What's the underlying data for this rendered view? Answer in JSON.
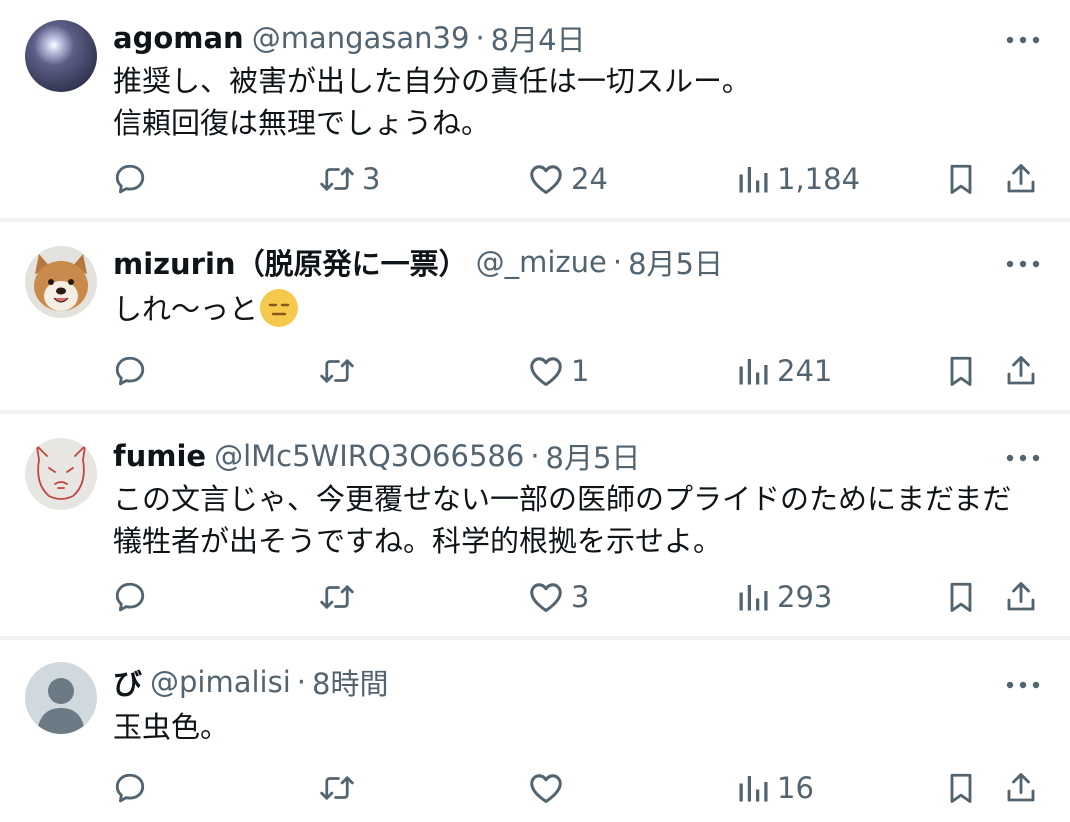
{
  "posts": [
    {
      "name": "agoman",
      "handle": "@mangasan39",
      "separator": "·",
      "time": "8月4日",
      "text": "推奨し、被害が出した自分の責任は一切スルー。\n信頼回復は無理でしょうね。",
      "replies": "",
      "reposts": "3",
      "likes": "24",
      "views": "1,184",
      "avatar": "dark-orb-avatar"
    },
    {
      "name": "mizurin（脱原発に一票）",
      "handle": "@_mizue",
      "separator": "·",
      "time": "8月5日",
      "text": "しれ〜っと",
      "emoji": "expressionless-face-emoji",
      "replies": "",
      "reposts": "",
      "likes": "1",
      "views": "241",
      "avatar": "dog-avatar"
    },
    {
      "name": "fumie",
      "handle": "@lMc5WIRQ3O66586",
      "separator": "·",
      "time": "8月5日",
      "text": "この文言じゃ、今更覆せない一部の医師のプライドのためにまだまだ\n犠牲者が出そうですね。科学的根拠を示せよ。",
      "replies": "",
      "reposts": "",
      "likes": "3",
      "views": "293",
      "avatar": "drawn-face-avatar"
    },
    {
      "name": "び",
      "handle": "@pimalisi",
      "separator": "·",
      "time": "8時間",
      "text": "玉虫色。",
      "replies": "",
      "reposts": "",
      "likes": "",
      "views": "16",
      "avatar": "default-avatar"
    }
  ],
  "colors": {
    "text": "#0f1419",
    "secondary": "#536471",
    "divider": "#eff3f4",
    "emoji": "#f6c94c"
  },
  "icons": [
    "reply-icon",
    "repost-icon",
    "like-icon",
    "views-icon",
    "bookmark-icon",
    "share-icon",
    "more-icon"
  ]
}
